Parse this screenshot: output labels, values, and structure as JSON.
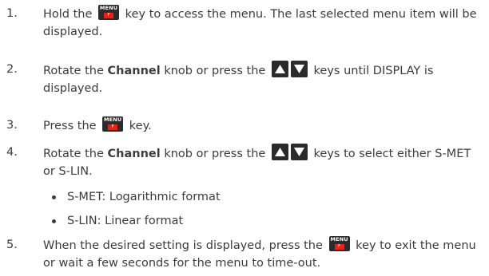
{
  "steps": [
    {
      "number": "1.",
      "pre": "Hold the",
      "post": "key to access the menu. The last selected menu item will be displayed."
    },
    {
      "number": "2.",
      "pre": "Rotate the",
      "bold": "Channel",
      "mid": "knob or press the",
      "post": "keys until DISPLAY is displayed."
    },
    {
      "number": "3.",
      "pre": "Press the",
      "post": "key."
    },
    {
      "number": "4.",
      "pre": "Rotate the",
      "bold": "Channel",
      "mid": "knob or press the",
      "post": "keys to select either S-MET or S-LIN.",
      "sub": [
        "S-MET: Logarithmic format",
        "S-LIN: Linear format"
      ]
    },
    {
      "number": "5.",
      "pre": "When the desired setting is displayed, press the",
      "post": "key to exit the menu or wait a few seconds for the menu to time-out."
    }
  ],
  "keys": {
    "menu_label": "MENU",
    "menu_sub": "F"
  }
}
